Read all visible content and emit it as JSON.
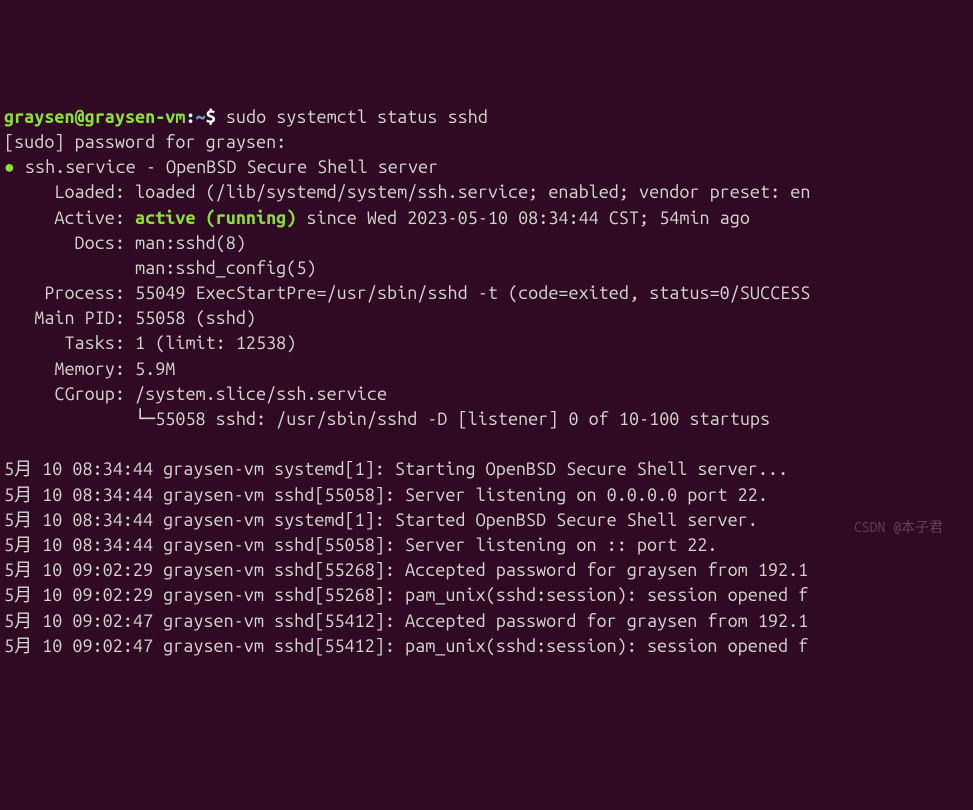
{
  "prompt": {
    "user_host": "graysen@graysen-vm",
    "sep": ":",
    "path": "~",
    "dollar": "$",
    "command": "sudo systemctl status sshd"
  },
  "sudo_line": "[sudo] password for graysen:",
  "service": {
    "name": "ssh.service - OpenBSD Secure Shell server",
    "loaded_label": "     Loaded: ",
    "loaded_value": "loaded (/lib/systemd/system/ssh.service; enabled; vendor preset: en",
    "active_label": "     Active: ",
    "active_status": "active (running)",
    "active_since": " since Wed 2023-05-10 08:34:44 CST; 54min ago",
    "docs_label": "       Docs: ",
    "docs_value1": "man:sshd(8)",
    "docs_value2": "             man:sshd_config(5)",
    "process_label": "    Process: ",
    "process_value": "55049 ExecStartPre=/usr/sbin/sshd -t (code=exited, status=0/SUCCESS",
    "mainpid_label": "   Main PID: ",
    "mainpid_value": "55058 (sshd)",
    "tasks_label": "      Tasks: ",
    "tasks_value": "1 (limit: 12538)",
    "memory_label": "     Memory: ",
    "memory_value": "5.9M",
    "cgroup_label": "     CGroup: ",
    "cgroup_value": "/system.slice/ssh.service",
    "cgroup_tree": "             └─55058 sshd: /usr/sbin/sshd -D [listener] 0 of 10-100 startups"
  },
  "log": {
    "l1": "5月 10 08:34:44 graysen-vm systemd[1]: Starting OpenBSD Secure Shell server...",
    "l2": "5月 10 08:34:44 graysen-vm sshd[55058]: Server listening on 0.0.0.0 port 22.",
    "l3": "5月 10 08:34:44 graysen-vm systemd[1]: Started OpenBSD Secure Shell server.",
    "l4": "5月 10 08:34:44 graysen-vm sshd[55058]: Server listening on :: port 22.",
    "l5": "5月 10 09:02:29 graysen-vm sshd[55268]: Accepted password for graysen from 192.1",
    "l6": "5月 10 09:02:29 graysen-vm sshd[55268]: pam_unix(sshd:session): session opened f",
    "l7": "5月 10 09:02:47 graysen-vm sshd[55412]: Accepted password for graysen from 192.1",
    "l8": "5月 10 09:02:47 graysen-vm sshd[55412]: pam_unix(sshd:session): session opened f"
  },
  "watermark": "CSDN @本子君"
}
